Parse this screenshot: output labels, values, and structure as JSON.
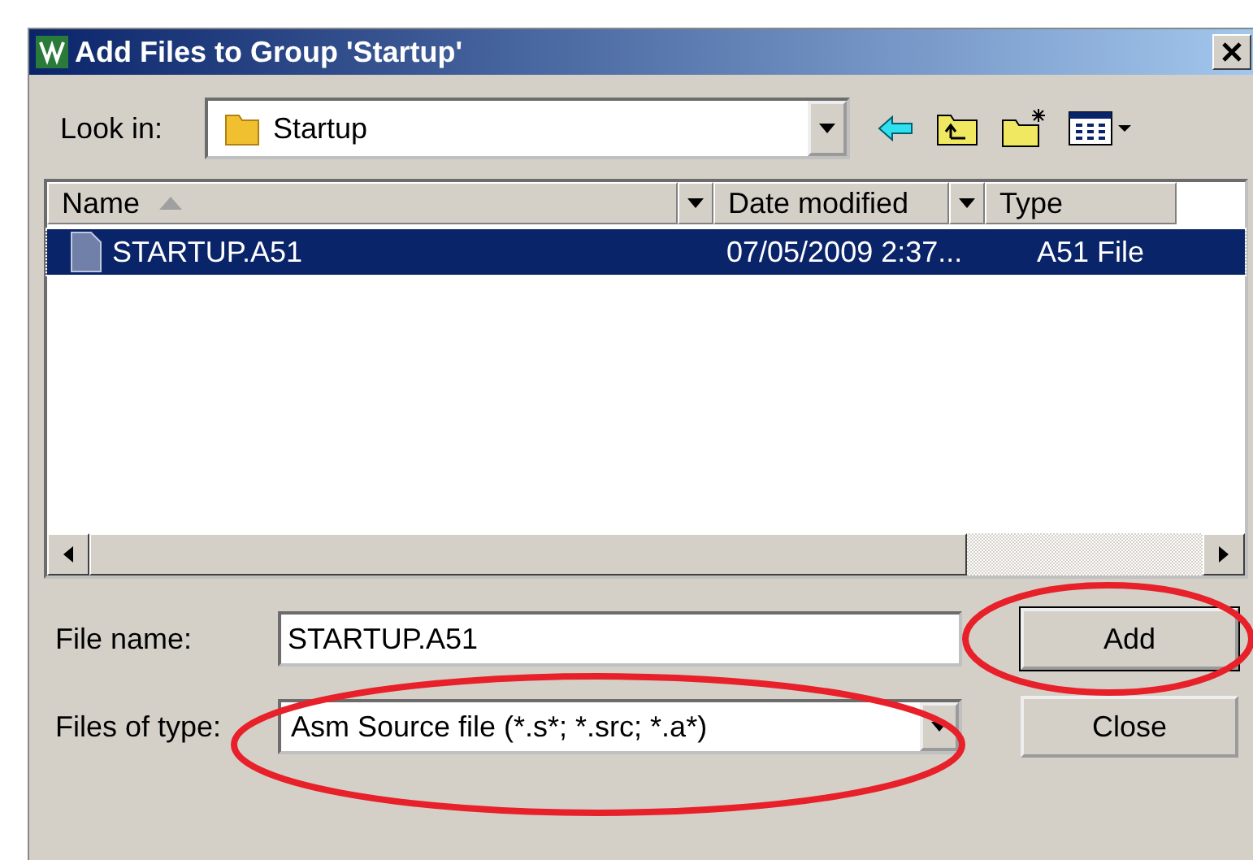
{
  "window": {
    "title": "Add Files to Group 'Startup'"
  },
  "look_in": {
    "label": "Look in:",
    "value": "Startup"
  },
  "columns": [
    {
      "label": "Name",
      "sorted": true
    },
    {
      "label": "Date modified",
      "sorted": false
    },
    {
      "label": "Type",
      "sorted": false
    }
  ],
  "files": [
    {
      "name": "STARTUP.A51",
      "date_modified": "07/05/2009 2:37...",
      "type": "A51 File",
      "selected": true
    }
  ],
  "file_name": {
    "label": "File name:",
    "value": "STARTUP.A51"
  },
  "file_type": {
    "label": "Files of type:",
    "value": "Asm Source file (*.s*; *.src; *.a*)",
    "circled": true
  },
  "buttons": [
    {
      "label": "Add",
      "circled": true
    },
    {
      "label": "Close",
      "circled": false
    }
  ]
}
